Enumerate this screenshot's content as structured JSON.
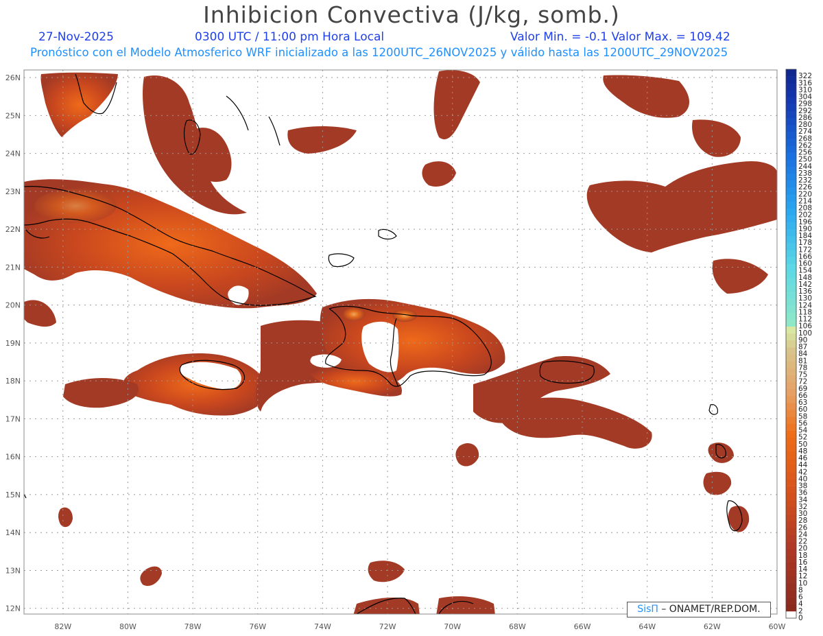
{
  "title": "Inhibicion Convectiva (J/kg, somb.)",
  "header": {
    "date": "27-Nov-2025",
    "time": "0300 UTC / 11:00 pm Hora Local",
    "minmax": "Valor Min. = -0.1  Valor Max. = 109.42",
    "model": "Pronóstico con el Modelo Atmosferico WRF inicializado a las 1200UTC_26NOV2025 y válido hasta las  1200UTC_29NOV2025"
  },
  "credit": {
    "brand": "SisΠ",
    "text": " – ONAMET/REP.DOM."
  },
  "map": {
    "lat_labels": [
      "26N",
      "25N",
      "24N",
      "23N",
      "22N",
      "21N",
      "20N",
      "19N",
      "18N",
      "17N",
      "16N",
      "15N",
      "14N",
      "13N",
      "12N"
    ],
    "lon_labels": [
      "82W",
      "80W",
      "78W",
      "76W",
      "74W",
      "72W",
      "70W",
      "68W",
      "66W",
      "64W",
      "62W",
      "60W"
    ],
    "grid": "dotted",
    "extent": {
      "lon_min": -83.2,
      "lon_max": -60,
      "lat_min": 11.85,
      "lat_max": 26.2
    }
  },
  "legend": {
    "levels": [
      "0",
      "2",
      "4",
      "6",
      "8",
      "10",
      "12",
      "14",
      "16",
      "18",
      "20",
      "22",
      "24",
      "26",
      "28",
      "30",
      "32",
      "34",
      "36",
      "38",
      "40",
      "42",
      "44",
      "46",
      "48",
      "50",
      "52",
      "54",
      "56",
      "58",
      "60",
      "63",
      "66",
      "69",
      "72",
      "75",
      "78",
      "81",
      "84",
      "87",
      "90",
      "100",
      "106",
      "112",
      "118",
      "124",
      "130",
      "136",
      "142",
      "148",
      "154",
      "160",
      "166",
      "172",
      "178",
      "184",
      "190",
      "196",
      "202",
      "208",
      "214",
      "220",
      "226",
      "232",
      "238",
      "244",
      "250",
      "256",
      "262",
      "268",
      "274",
      "280",
      "286",
      "292",
      "298",
      "304",
      "310",
      "316",
      "322"
    ]
  },
  "colors": {
    "shade_low": "#a33a25",
    "shade_mid": "#e05518",
    "shade_high": "#e8e888",
    "coast": "#000000",
    "title": "#444444",
    "header": "#2040e8",
    "model": "#1f90ff"
  }
}
